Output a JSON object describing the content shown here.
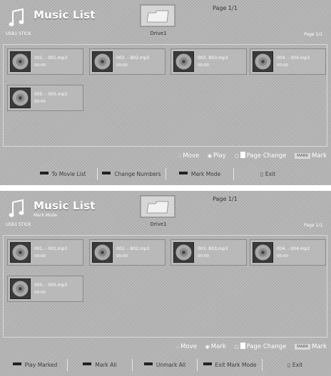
{
  "screens": [
    {
      "header": {
        "title": "Music List",
        "device": "USB1 STICK",
        "drive": "Drive1",
        "page_top": "Page 1/1",
        "page_right": "Page 1/1"
      },
      "tiles": [
        {
          "name": "001. - 001.mp3",
          "time": "00:00"
        },
        {
          "name": "002. - B02.mp3",
          "time": "00:00"
        },
        {
          "name": "003. B03.mp3",
          "time": "00:00"
        },
        {
          "name": "004. - 004.mp3",
          "time": "00:00"
        },
        {
          "name": "005. - 005.mp3",
          "time": "00:00"
        }
      ],
      "hints": {
        "move": "Move",
        "select": "Play",
        "page": "Page Change",
        "mark_key": "MARK",
        "mark": "Mark"
      },
      "buttons": [
        "To Movie List",
        "Change Numbers",
        "Mark Mode",
        "Exit"
      ]
    },
    {
      "header": {
        "title": "Music List",
        "subtitle": "Mark Mode",
        "device": "USB1 STICK",
        "drive": "Drive1",
        "page_top": "Page 1/1",
        "page_right": "Page 1/1"
      },
      "tiles": [
        {
          "name": "001. - 001.mp3",
          "time": "00:00"
        },
        {
          "name": "002. - B02.mp3",
          "time": "00:00"
        },
        {
          "name": "003. B03.mp3",
          "time": "00:00"
        },
        {
          "name": "004. - 004.mp3",
          "time": "00:00"
        },
        {
          "name": "005. - 005.mp3",
          "time": "00:00"
        }
      ],
      "hints": {
        "move": "Move",
        "select": "Mark",
        "page": "Page Change",
        "mark_key": "MARK",
        "mark": "Mark"
      },
      "buttons": [
        "Play Marked",
        "Mark All",
        "Unmark All",
        "Exit Mark Mode",
        "Exit"
      ]
    }
  ],
  "icons": {
    "app": "music-note-icon",
    "drive": "folder-icon",
    "thumb": "disc-icon",
    "move": "arrows-icon",
    "select": "ok-icon",
    "page": "page-key-icon",
    "exit": "exit-icon"
  },
  "colors": {
    "background": "#b4b4b4",
    "text": "#ffffff",
    "button_swatch": "#222222"
  }
}
